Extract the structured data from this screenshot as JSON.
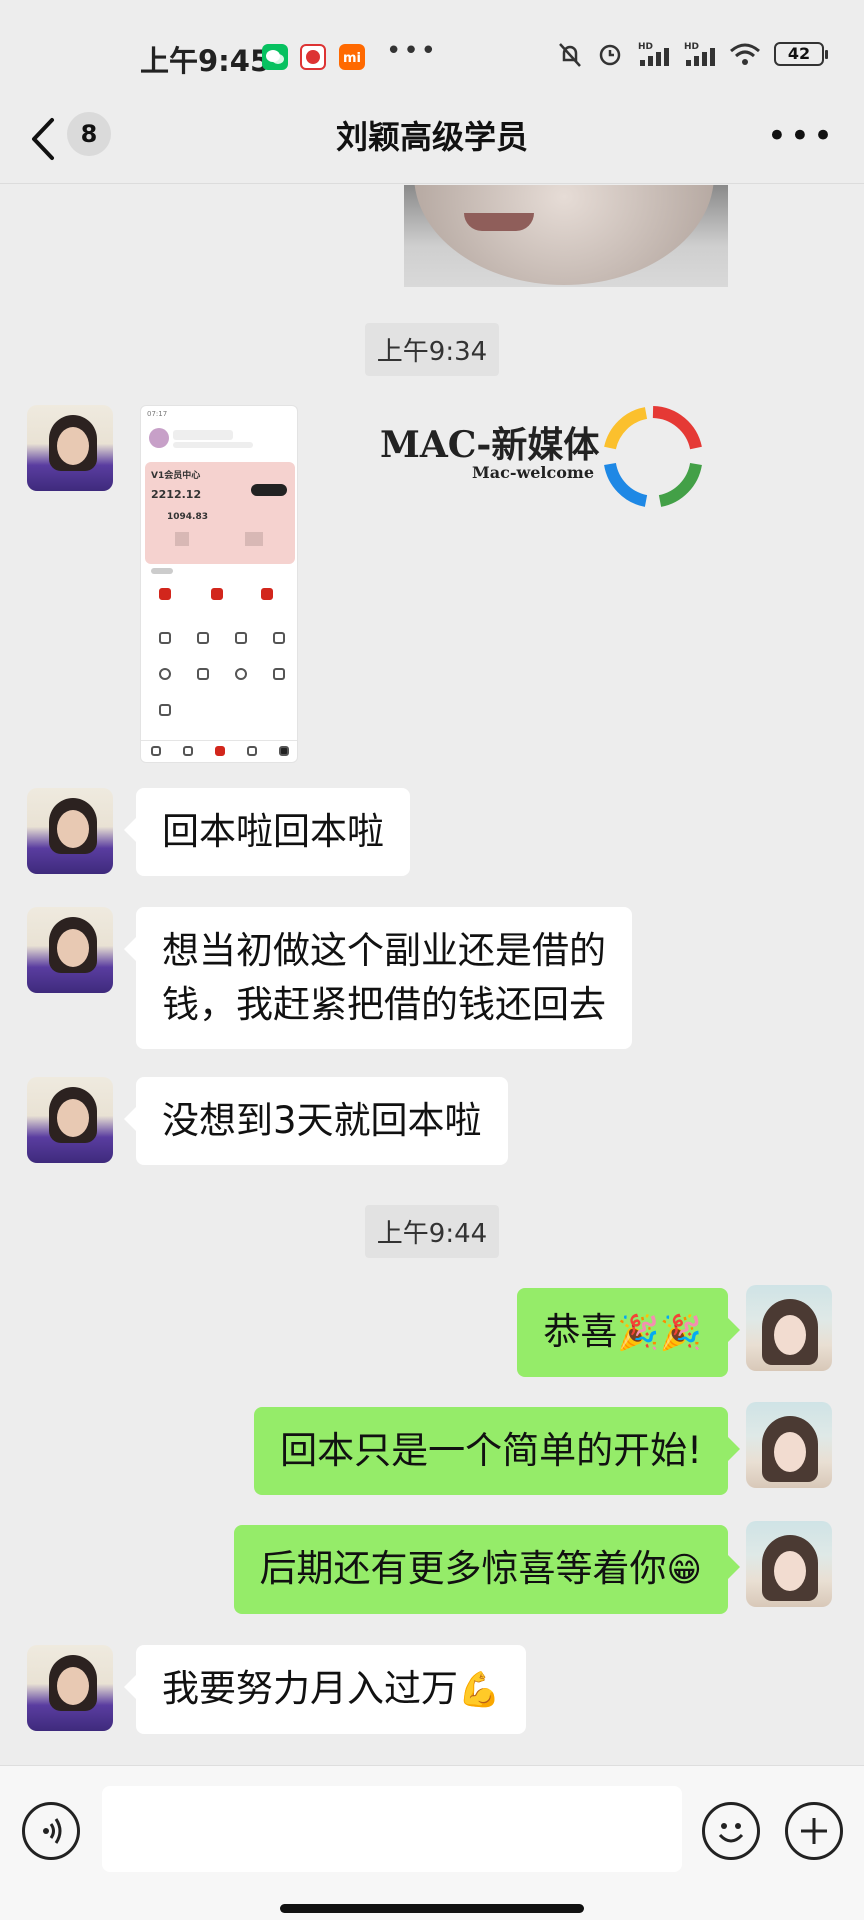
{
  "status_bar": {
    "time": "上午9:45",
    "battery": "42",
    "network_labels": [
      "HD",
      "HD"
    ]
  },
  "nav": {
    "unread_count": "8",
    "title": "刘颖高级学员"
  },
  "shared_image": {
    "app_card_title": "V1会员中心",
    "app_card_value": "2212.12",
    "app_card_stat": "1094.83",
    "logo_text": "MAC-新媒体",
    "logo_subtext": "Mac-welcome"
  },
  "messages": [
    {
      "type": "timestamp",
      "text": "上午9:34"
    },
    {
      "type": "image",
      "side": "left"
    },
    {
      "type": "text",
      "side": "left",
      "text": "回本啦回本啦"
    },
    {
      "type": "text",
      "side": "left",
      "lines": [
        "想当初做这个副业还是借的",
        "钱，我赶紧把借的钱还回去"
      ]
    },
    {
      "type": "text",
      "side": "left",
      "text": "没想到3天就回本啦"
    },
    {
      "type": "timestamp",
      "text": "上午9:44"
    },
    {
      "type": "text",
      "side": "right",
      "text": "恭喜",
      "emoji": "🎉🎉"
    },
    {
      "type": "text",
      "side": "right",
      "text": "回本只是一个简单的开始!"
    },
    {
      "type": "text",
      "side": "right",
      "text": "后期还有更多惊喜等着你",
      "emoji": "😁"
    },
    {
      "type": "text",
      "side": "left",
      "text": "我要努力月入过万",
      "emoji": "💪"
    }
  ],
  "icons": {
    "back": "chevron-left-icon",
    "more": "more-icon",
    "voice": "voice-icon",
    "emoji": "emoji-icon",
    "plus": "plus-icon"
  },
  "colors": {
    "background": "#ededed",
    "right_bubble": "#95ec69",
    "left_bubble": "#ffffff"
  }
}
